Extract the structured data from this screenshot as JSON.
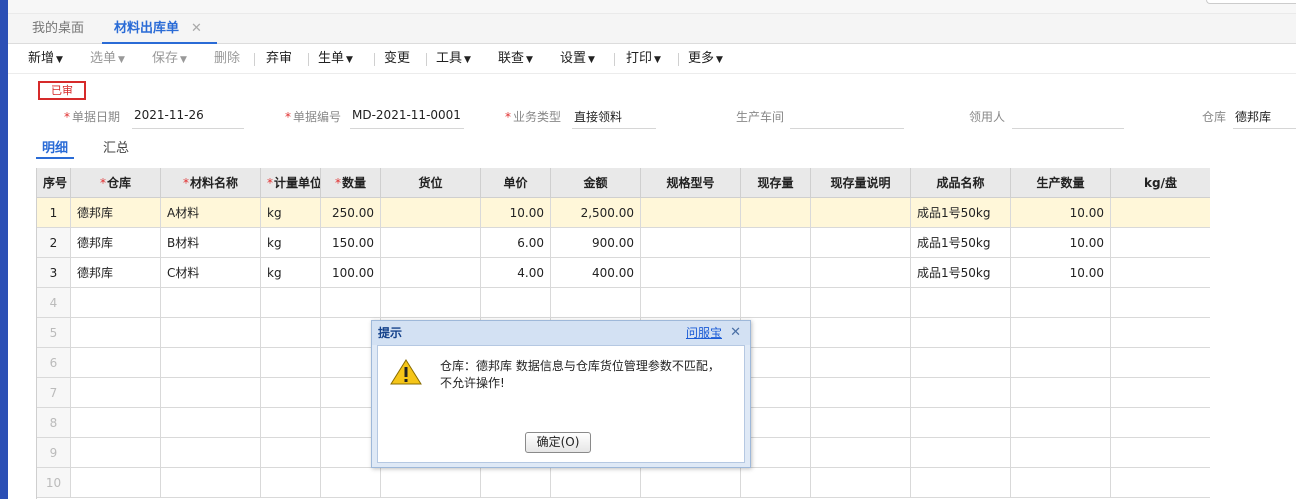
{
  "tabs": [
    {
      "label": "我的桌面"
    },
    {
      "label": "材料出库单",
      "close": "✕"
    }
  ],
  "toolbar": [
    {
      "label": "新增",
      "caret": true,
      "disabled": false
    },
    {
      "label": "选单",
      "caret": true,
      "disabled": true
    },
    {
      "label": "保存",
      "caret": true,
      "disabled": true
    },
    {
      "label": "删除",
      "caret": false,
      "disabled": true
    },
    {
      "label": "弃审",
      "caret": false,
      "disabled": false
    },
    {
      "label": "生单",
      "caret": true,
      "disabled": false
    },
    {
      "label": "变更",
      "caret": false,
      "disabled": false
    },
    {
      "label": "工具",
      "caret": true,
      "disabled": false
    },
    {
      "label": "联查",
      "caret": true,
      "disabled": false
    },
    {
      "label": "设置",
      "caret": true,
      "disabled": false
    },
    {
      "label": "打印",
      "caret": true,
      "disabled": false
    },
    {
      "label": "更多",
      "caret": true,
      "disabled": false
    }
  ],
  "status_stamp": "已审",
  "header_fields": {
    "date": {
      "label": "单据日期",
      "value": "2021-11-26"
    },
    "code": {
      "label": "单据编号",
      "value": "MD-2021-11-0001"
    },
    "biz_type": {
      "label": "业务类型",
      "value": "直接领料"
    },
    "workshop": {
      "label": "生产车间",
      "value": ""
    },
    "receiver": {
      "label": "领用人",
      "value": ""
    },
    "warehouse": {
      "label": "仓库",
      "value": "德邦库"
    }
  },
  "subtabs": {
    "detail": "明细",
    "summary": "汇总"
  },
  "grid": {
    "columns": [
      {
        "label": "序号",
        "required": false
      },
      {
        "label": "仓库",
        "required": true
      },
      {
        "label": "材料名称",
        "required": true
      },
      {
        "label": "计量单位",
        "required": true
      },
      {
        "label": "数量",
        "required": true
      },
      {
        "label": "货位",
        "required": false
      },
      {
        "label": "单价",
        "required": false
      },
      {
        "label": "金额",
        "required": false
      },
      {
        "label": "规格型号",
        "required": false
      },
      {
        "label": "现存量",
        "required": false
      },
      {
        "label": "现存量说明",
        "required": false
      },
      {
        "label": "成品名称",
        "required": false
      },
      {
        "label": "生产数量",
        "required": false
      },
      {
        "label": "kg/盘",
        "required": false
      }
    ],
    "rows": [
      {
        "seq": "1",
        "warehouse": "德邦库",
        "material": "A材料",
        "unit": "kg",
        "qty": "250.00",
        "location": "",
        "price": "10.00",
        "amount": "2,500.00",
        "spec": "",
        "stock": "",
        "stock_note": "",
        "product": "成品1号50kg",
        "prod_qty": "10.00",
        "kg_per_reel": ""
      },
      {
        "seq": "2",
        "warehouse": "德邦库",
        "material": "B材料",
        "unit": "kg",
        "qty": "150.00",
        "location": "",
        "price": "6.00",
        "amount": "900.00",
        "spec": "",
        "stock": "",
        "stock_note": "",
        "product": "成品1号50kg",
        "prod_qty": "10.00",
        "kg_per_reel": ""
      },
      {
        "seq": "3",
        "warehouse": "德邦库",
        "material": "C材料",
        "unit": "kg",
        "qty": "100.00",
        "location": "",
        "price": "4.00",
        "amount": "400.00",
        "spec": "",
        "stock": "",
        "stock_note": "",
        "product": "成品1号50kg",
        "prod_qty": "10.00",
        "kg_per_reel": ""
      }
    ],
    "empty_rows": [
      "4",
      "5",
      "6",
      "7",
      "8",
      "9",
      "10"
    ]
  },
  "dialog": {
    "title": "提示",
    "help_link": "问服宝",
    "close": "✕",
    "message_line1": "仓库：德邦库 数据信息与仓库货位管理参数不匹配，",
    "message_line2": "不允许操作!",
    "ok_label": "确定(O)"
  },
  "colors": {
    "accent": "#2a6bd6",
    "stamp": "#d62a2a",
    "selected_row": "#fff7d9"
  }
}
